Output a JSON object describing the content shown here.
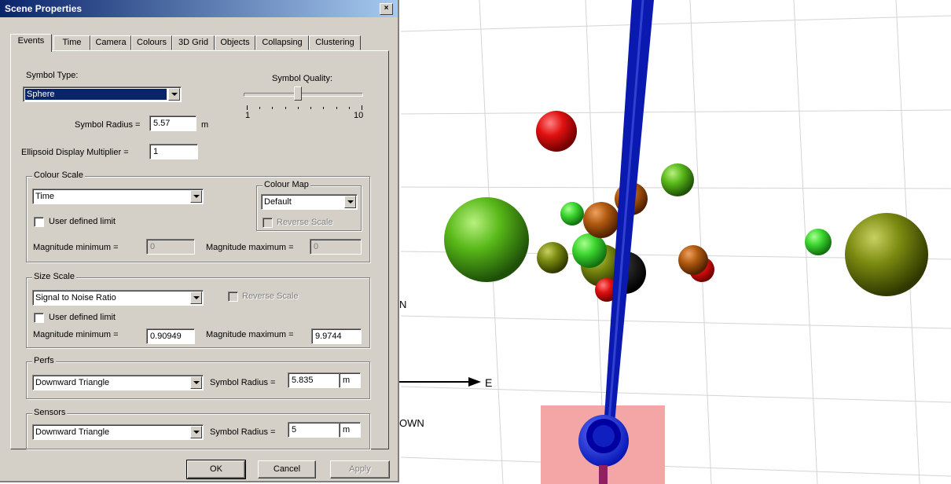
{
  "dialog": {
    "title": "Scene Properties",
    "close_label": "×",
    "tabs": [
      "Events",
      "Time",
      "Camera",
      "Colours",
      "3D Grid",
      "Objects",
      "Collapsing",
      "Clustering"
    ],
    "active_tab": "Events",
    "symbol_type": {
      "label": "Symbol Type:",
      "value": "Sphere"
    },
    "symbol_quality": {
      "label": "Symbol Quality:",
      "min_label": "1",
      "max_label": "10",
      "min": 1,
      "max": 10,
      "value": 5
    },
    "symbol_radius": {
      "label": "Symbol Radius =",
      "value": "5.57",
      "unit": "m"
    },
    "ellipsoid": {
      "label": "Ellipsoid Display Multiplier =",
      "value": "1"
    },
    "colour_scale": {
      "title": "Colour Scale",
      "value": "Time",
      "user_defined": "User defined limit",
      "mag_min_label": "Magnitude minimum =",
      "mag_min_value": "0",
      "mag_max_label": "Magnitude maximum =",
      "mag_max_value": "0",
      "colour_map": {
        "title": "Colour Map",
        "value": "Default",
        "reverse": "Reverse Scale"
      }
    },
    "size_scale": {
      "title": "Size Scale",
      "value": "Signal to Noise Ratio",
      "reverse": "Reverse Scale",
      "user_defined": "User defined limit",
      "mag_min_label": "Magnitude minimum =",
      "mag_min_value": "0.90949",
      "mag_max_label": "Magnitude maximum =",
      "mag_max_value": "9.9744"
    },
    "perfs": {
      "title": "Perfs",
      "value": "Downward Triangle",
      "radius_label": "Symbol Radius =",
      "radius_value": "5.835",
      "unit": "m"
    },
    "sensors": {
      "title": "Sensors",
      "value": "Downward Triangle",
      "radius_label": "Symbol Radius =",
      "radius_value": "5",
      "unit": "m"
    },
    "buttons": {
      "ok": "OK",
      "cancel": "Cancel",
      "apply": "Apply"
    }
  },
  "scene": {
    "axis_e_label": "E",
    "axis_n_label": "N",
    "axis_down_label": "OWN",
    "colors": {
      "well": "#0a1ab0",
      "plane": "#f4a6a6",
      "grid": "#d0d0d0",
      "red": "#e01010",
      "green": "#38d838",
      "olive": "#7a8a10",
      "brown": "#b05a10"
    }
  }
}
